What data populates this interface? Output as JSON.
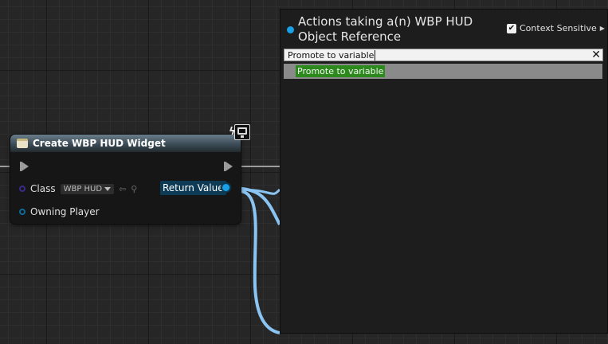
{
  "node": {
    "title": "Create WBP HUD Widget",
    "class_label": "Class",
    "class_value": "WBP HUD",
    "owning_player_label": "Owning Player",
    "return_value_label": "Return Value"
  },
  "popup": {
    "title": "Actions taking a(n) WBP HUD Object Reference",
    "context_sensitive_label": "Context Sensitive",
    "context_sensitive_checked": true,
    "search_value": "Promote to variable",
    "results": [
      "Promote to variable"
    ]
  },
  "colors": {
    "object_pin": "#1aa0e6",
    "wire": "#8ac4f2",
    "highlight": "#2c8a1d",
    "node_header": "#3c4c57"
  },
  "icons": {
    "node": "widget-icon",
    "dev": "lightning-icon",
    "monitor": "monitor-icon",
    "close": "close-icon",
    "arrow": "chevron-right-icon"
  }
}
